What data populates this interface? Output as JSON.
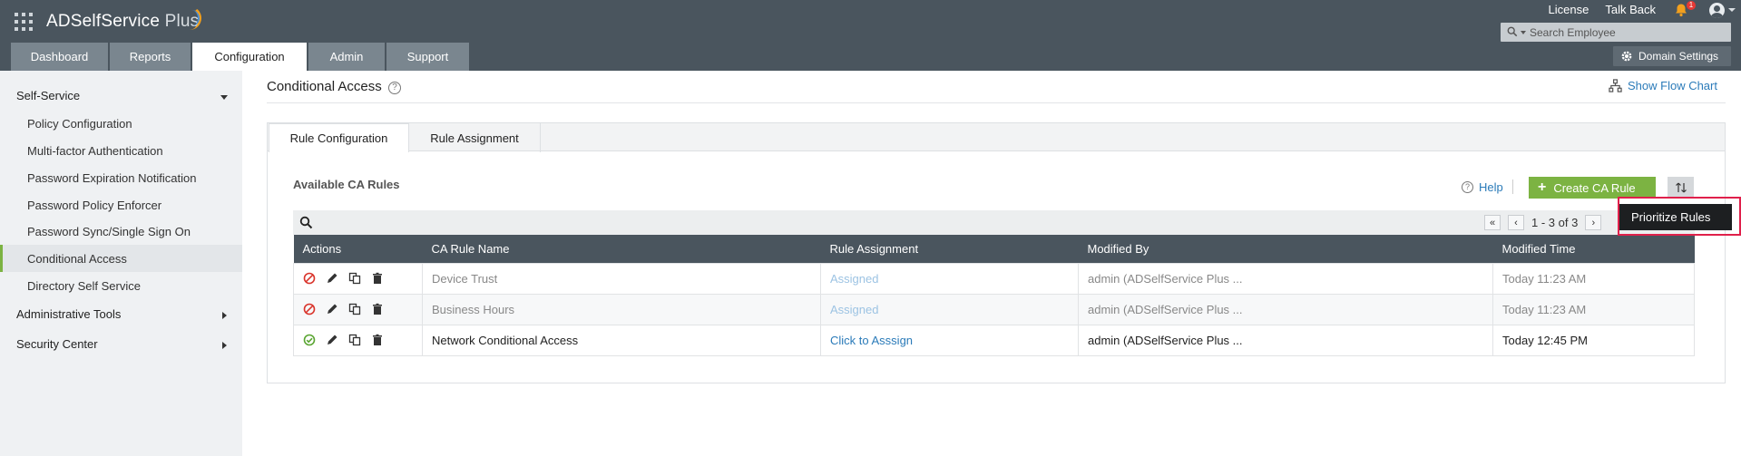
{
  "app": {
    "brand_name": "ADSelfService",
    "brand_suffix": "Plus"
  },
  "header": {
    "license_label": "License",
    "talkback_label": "Talk Back",
    "notification_count": "1",
    "search_placeholder": "Search Employee",
    "domain_settings_label": "Domain Settings"
  },
  "nav_tabs": [
    {
      "label": "Dashboard"
    },
    {
      "label": "Reports"
    },
    {
      "label": "Configuration",
      "active": true
    },
    {
      "label": "Admin"
    },
    {
      "label": "Support"
    }
  ],
  "sidebar": {
    "self_service_label": "Self-Service",
    "items": [
      {
        "label": "Policy Configuration"
      },
      {
        "label": "Multi-factor Authentication"
      },
      {
        "label": "Password Expiration Notification"
      },
      {
        "label": "Password Policy Enforcer"
      },
      {
        "label": "Password Sync/Single Sign On"
      },
      {
        "label": "Conditional Access",
        "active": true
      },
      {
        "label": "Directory Self Service"
      }
    ],
    "admin_tools_label": "Administrative Tools",
    "security_center_label": "Security Center"
  },
  "main": {
    "page_title": "Conditional Access",
    "flow_chart_label": "Show Flow Chart",
    "tabs": [
      {
        "label": "Rule Configuration",
        "active": true
      },
      {
        "label": "Rule Assignment"
      }
    ],
    "section_title": "Available CA Rules",
    "help_label": "Help",
    "create_label": "Create CA Rule",
    "tooltip_label": "Prioritize Rules",
    "pager_text": "1 - 3 of 3",
    "columns": [
      "Actions",
      "CA Rule Name",
      "Rule Assignment",
      "Modified By",
      "Modified Time"
    ],
    "rows": [
      {
        "status": "disabled",
        "name": "Device Trust",
        "assignment": "Assigned",
        "modified_by": "admin (ADSelfService Plus ...",
        "modified_time": "Today 11:23 AM"
      },
      {
        "status": "disabled",
        "name": "Business Hours",
        "assignment": "Assigned",
        "modified_by": "admin (ADSelfService Plus ...",
        "modified_time": "Today 11:23 AM"
      },
      {
        "status": "enabled",
        "name": "Network Conditional Access",
        "assignment": "Click to Asssign",
        "modified_by": "admin (ADSelfService Plus ...",
        "modified_time": "Today 12:45 PM"
      }
    ]
  },
  "colors": {
    "header_bg": "#4a555e",
    "accent_green": "#7cb342",
    "link_blue": "#2b7bb9",
    "highlight_red": "#e0204b"
  }
}
